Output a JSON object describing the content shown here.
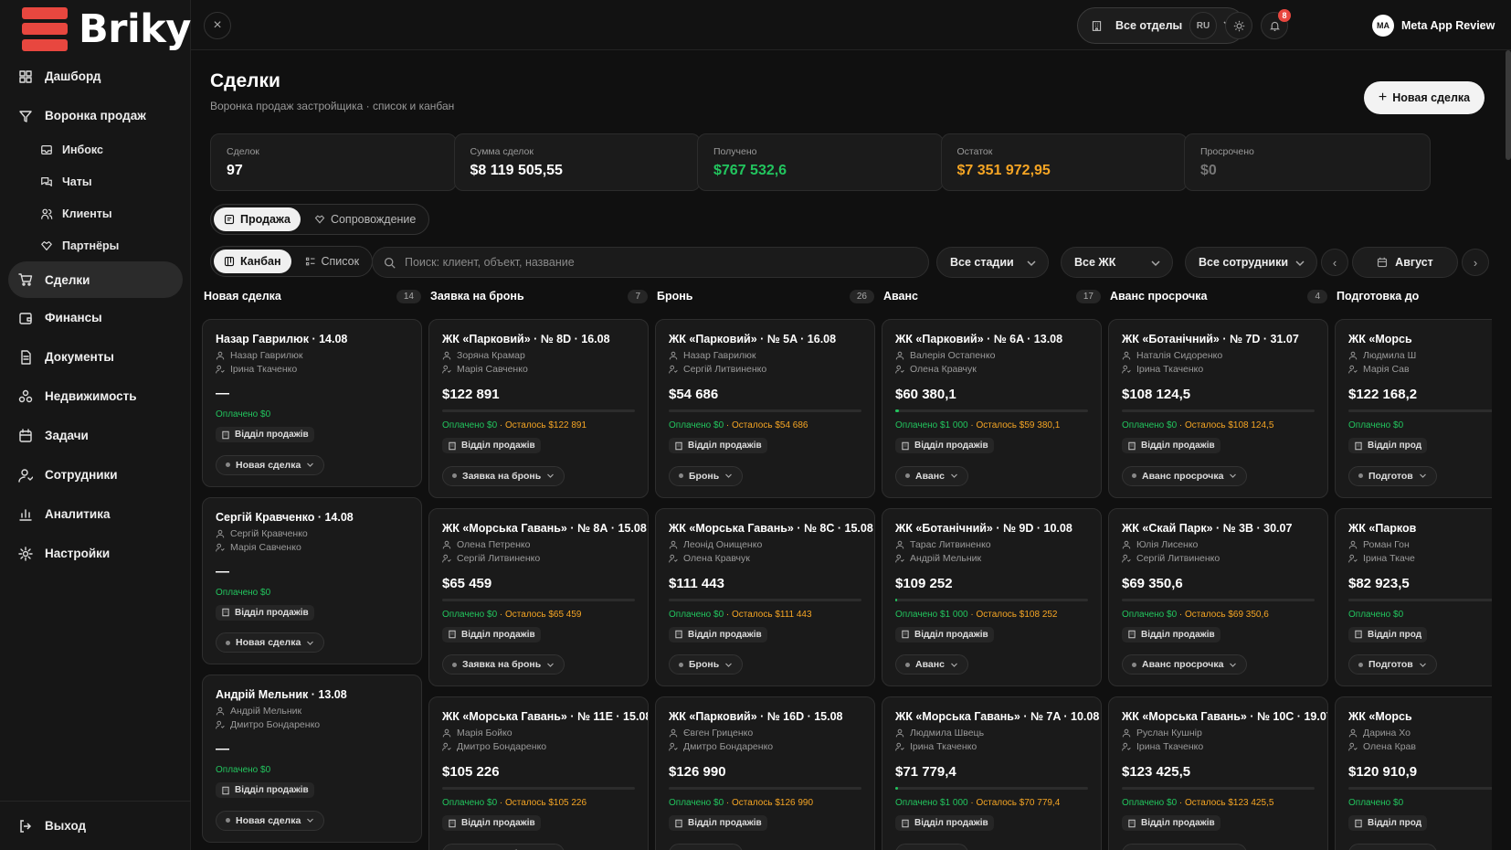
{
  "brand": {
    "name": "Briky",
    "color": "#e8473f"
  },
  "colors": {
    "paid": "#22c55e",
    "remaining": "#f5a524",
    "accent": "#e8473f"
  },
  "sidebar": {
    "items": [
      {
        "label": "Дашборд",
        "icon": "dashboard-icon"
      },
      {
        "label": "Воронка продаж",
        "icon": "funnel-icon"
      },
      {
        "label": "Инбокс",
        "icon": "inbox-icon",
        "sub": true
      },
      {
        "label": "Чаты",
        "icon": "chats-icon",
        "sub": true
      },
      {
        "label": "Клиенты",
        "icon": "clients-icon",
        "sub": true
      },
      {
        "label": "Партнёры",
        "icon": "partners-icon",
        "sub": true
      },
      {
        "label": "Сделки",
        "icon": "cart-icon",
        "active": true
      },
      {
        "label": "Финансы",
        "icon": "wallet-icon"
      },
      {
        "label": "Документы",
        "icon": "document-icon"
      },
      {
        "label": "Недвижимость",
        "icon": "property-icon"
      },
      {
        "label": "Задачи",
        "icon": "calendar-icon"
      },
      {
        "label": "Сотрудники",
        "icon": "employees-icon"
      },
      {
        "label": "Аналитика",
        "icon": "analytics-icon"
      },
      {
        "label": "Настройки",
        "icon": "settings-icon"
      }
    ],
    "logout": "Выход"
  },
  "topbar": {
    "department": "Все отделы",
    "lang": "RU",
    "notifications": "8",
    "user_initials": "MA",
    "user_name": "Meta App Review"
  },
  "page": {
    "title": "Сделки",
    "subtitle": "Воронка продаж застройщика · список и канбан",
    "new_button": "Новая сделка"
  },
  "stats": [
    {
      "label": "Сделок",
      "value": "97",
      "color": "#ffffff"
    },
    {
      "label": "Сумма сделок",
      "value": "$8 119 505,55",
      "color": "#ffffff"
    },
    {
      "label": "Получено",
      "value": "$767 532,6",
      "color": "#22c55e"
    },
    {
      "label": "Остаток",
      "value": "$7 351 972,95",
      "color": "#f5a524"
    },
    {
      "label": "Просрочено",
      "value": "$0",
      "color": "#777777"
    }
  ],
  "tabs": {
    "sale": "Продажа",
    "support": "Сопровождение"
  },
  "views": {
    "kanban": "Канбан",
    "list": "Список"
  },
  "filters": {
    "search_placeholder": "Поиск: клиент, объект, название",
    "stages": "Все стадии",
    "complex": "Все ЖК",
    "employees": "Все сотрудники",
    "month": "Август"
  },
  "columns": [
    {
      "name": "Новая сделка",
      "count": "14",
      "cards": [
        {
          "title": "Назар Гаврилюк · 14.08",
          "client": "Назар Гаврилюк",
          "agent": "Ірина Ткаченко",
          "amount": "—",
          "paid": "Оплачено $0",
          "dept": "Відділ продажів",
          "stage": "Новая сделка"
        },
        {
          "title": "Сергій Кравченко · 14.08",
          "client": "Сергій Кравченко",
          "agent": "Марія Савченко",
          "amount": "—",
          "paid": "Оплачено $0",
          "dept": "Відділ продажів",
          "stage": "Новая сделка"
        },
        {
          "title": "Андрій Мельник · 13.08",
          "client": "Андрій Мельник",
          "agent": "Дмитро Бондаренко",
          "amount": "—",
          "paid": "Оплачено $0",
          "dept": "Відділ продажів",
          "stage": "Новая сделка"
        }
      ]
    },
    {
      "name": "Заявка на бронь",
      "count": "7",
      "cards": [
        {
          "title": "ЖК «Парковий» · № 8D · 16.08",
          "client": "Зоряна Крамар",
          "agent": "Марія Савченко",
          "amount": "$122 891",
          "progress": 0,
          "paid": "Оплачено $0",
          "remaining": "· Осталось $122 891",
          "dept": "Відділ продажів",
          "stage": "Заявка на бронь"
        },
        {
          "title": "ЖК «Морська Гавань» · № 8А · 15.08",
          "client": "Олена Петренко",
          "agent": "Сергій Литвиненко",
          "amount": "$65 459",
          "progress": 0,
          "paid": "Оплачено $0",
          "remaining": "· Осталось $65 459",
          "dept": "Відділ продажів",
          "stage": "Заявка на бронь"
        },
        {
          "title": "ЖК «Морська Гавань» · № 11E · 15.08",
          "client": "Марія Бойко",
          "agent": "Дмитро Бондаренко",
          "amount": "$105 226",
          "progress": 0,
          "paid": "Оплачено $0",
          "remaining": "· Осталось $105 226",
          "dept": "Відділ продажів",
          "stage": "Заявка на бронь"
        }
      ]
    },
    {
      "name": "Бронь",
      "count": "26",
      "cards": [
        {
          "title": "ЖК «Парковий» · № 5A · 16.08",
          "client": "Назар Гаврилюк",
          "agent": "Сергій Литвиненко",
          "amount": "$54 686",
          "progress": 0,
          "paid": "Оплачено $0",
          "remaining": "· Осталось $54 686",
          "dept": "Відділ продажів",
          "stage": "Бронь"
        },
        {
          "title": "ЖК «Морська Гавань» · № 8C · 15.08",
          "client": "Леонід Онищенко",
          "agent": "Олена Кравчук",
          "amount": "$111 443",
          "progress": 0,
          "paid": "Оплачено $0",
          "remaining": "· Осталось $111 443",
          "dept": "Відділ продажів",
          "stage": "Бронь"
        },
        {
          "title": "ЖК «Парковий» · № 16D · 15.08",
          "client": "Євген Гриценко",
          "agent": "Дмитро Бондаренко",
          "amount": "$126 990",
          "progress": 0,
          "paid": "Оплачено $0",
          "remaining": "· Осталось $126 990",
          "dept": "Відділ продажів",
          "stage": "Бронь"
        }
      ]
    },
    {
      "name": "Аванс",
      "count": "17",
      "cards": [
        {
          "title": "ЖК «Парковий» · № 6A · 13.08",
          "client": "Валерія Остапенко",
          "agent": "Олена Кравчук",
          "amount": "$60 380,1",
          "progress": 0.017,
          "paid": "Оплачено $1 000",
          "remaining": "· Осталось $59 380,1",
          "dept": "Відділ продажів",
          "stage": "Аванс"
        },
        {
          "title": "ЖК «Ботанічний» · № 9D · 10.08",
          "client": "Тарас Литвиненко",
          "agent": "Андрій Мельник",
          "amount": "$109 252",
          "progress": 0.009,
          "paid": "Оплачено $1 000",
          "remaining": "· Осталось $108 252",
          "dept": "Відділ продажів",
          "stage": "Аванс"
        },
        {
          "title": "ЖК «Морська Гавань» · № 7A · 10.08",
          "client": "Людмила Швець",
          "agent": "Ірина Ткаченко",
          "amount": "$71 779,4",
          "progress": 0.014,
          "paid": "Оплачено $1 000",
          "remaining": "· Осталось $70 779,4",
          "dept": "Відділ продажів",
          "stage": "Аванс"
        }
      ]
    },
    {
      "name": "Аванс просрочка",
      "count": "4",
      "cards": [
        {
          "title": "ЖК «Ботанічний» · № 7D · 31.07",
          "client": "Наталія Сидоренко",
          "agent": "Ірина Ткаченко",
          "amount": "$108 124,5",
          "progress": 0,
          "paid": "Оплачено $0",
          "remaining": "· Осталось $108 124,5",
          "dept": "Відділ продажів",
          "stage": "Аванс просрочка"
        },
        {
          "title": "ЖК «Скай Парк» · № 3B · 30.07",
          "client": "Юлія Лисенко",
          "agent": "Сергій Литвиненко",
          "amount": "$69 350,6",
          "progress": 0,
          "paid": "Оплачено $0",
          "remaining": "· Осталось $69 350,6",
          "dept": "Відділ продажів",
          "stage": "Аванс просрочка"
        },
        {
          "title": "ЖК «Морська Гавань» · № 10C · 19.07",
          "client": "Руслан Кушнір",
          "agent": "Ірина Ткаченко",
          "amount": "$123 425,5",
          "progress": 0,
          "paid": "Оплачено $0",
          "remaining": "· Осталось $123 425,5",
          "dept": "Відділ продажів",
          "stage": "Аванс просрочка"
        }
      ]
    },
    {
      "name": "Подготовка до",
      "count": "",
      "cards": [
        {
          "title": "ЖК «Морсь",
          "client": "Людмила Ш",
          "agent": "Марія Сав",
          "amount": "$122 168,2",
          "progress": 0,
          "paid": "Оплачено $0",
          "remaining": "",
          "dept": "Відділ прод",
          "stage": "Подготов"
        },
        {
          "title": "ЖК «Парков",
          "client": "Роман Гон",
          "agent": "Ірина Ткаче",
          "amount": "$82 923,5",
          "progress": 0,
          "paid": "Оплачено $0",
          "remaining": "",
          "dept": "Відділ прод",
          "stage": "Подготов"
        },
        {
          "title": "ЖК «Морсь",
          "client": "Дарина Хо",
          "agent": "Олена Крав",
          "amount": "$120 910,9",
          "progress": 0,
          "paid": "Оплачено $0",
          "remaining": "",
          "dept": "Відділ прод",
          "stage": "Подготов"
        }
      ]
    }
  ]
}
